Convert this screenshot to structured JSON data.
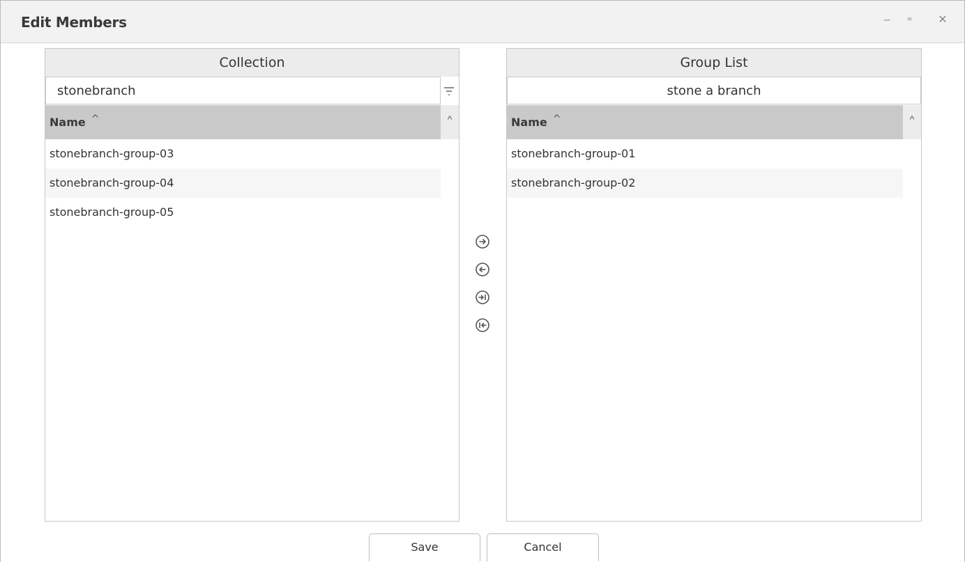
{
  "dialog": {
    "title": "Edit Members",
    "window_controls": [
      "minimize-icon",
      "maximize-icon",
      "close-icon"
    ],
    "minimize_glyph": "–",
    "maximize_glyph": "ˣˣ",
    "close_glyph": "✕"
  },
  "collection": {
    "header": "Collection",
    "filter_value": "stonebranch",
    "filter_icon": "filter-icon",
    "column_name": "Name",
    "sort_glyph": "^",
    "scroll_glyph": "^",
    "rows": [
      "stonebranch-group-03",
      "stonebranch-group-04",
      "stonebranch-group-05"
    ]
  },
  "group_list": {
    "header": "Group List",
    "filter_value": "stone a branch",
    "column_name": "Name",
    "sort_glyph": "^",
    "scroll_glyph": "^",
    "rows": [
      "stonebranch-group-01",
      "stonebranch-group-02"
    ]
  },
  "transfer_buttons": [
    "move-right-icon",
    "move-left-icon",
    "move-all-right-icon",
    "move-all-left-icon"
  ],
  "footer": {
    "save_label": "Save",
    "cancel_label": "Cancel"
  },
  "colors": {
    "title_bar": "#f2f2f2",
    "panel_header": "#ececec",
    "grid_header": "#c9c9c9",
    "border": "#c7c7c7"
  }
}
